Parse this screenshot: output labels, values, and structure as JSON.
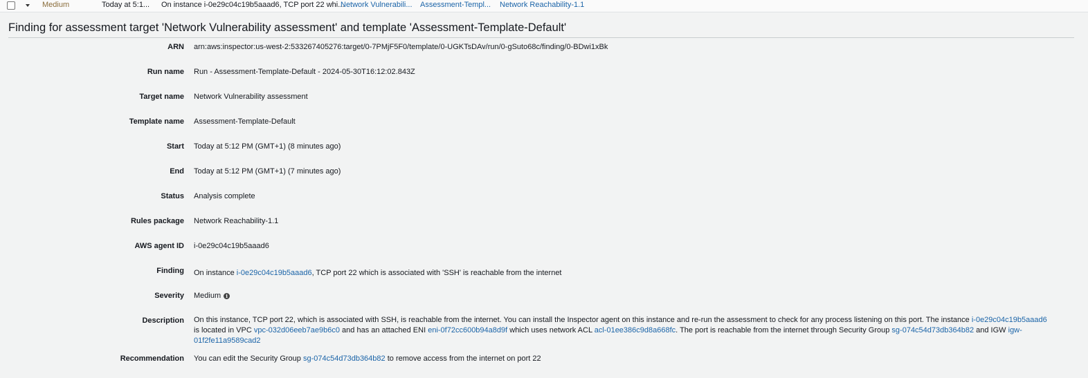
{
  "list_row": {
    "severity": "Medium",
    "date": "Today at 5:1...",
    "finding": "On instance i-0e29c04c19b5aaad6, TCP port 22 whi...",
    "target": "Network Vulnerabili...",
    "template": "Assessment-Templ...",
    "rules_package": "Network Reachability-1.1"
  },
  "panel": {
    "title": "Finding for assessment target 'Network Vulnerability assessment' and template 'Assessment-Template-Default'"
  },
  "fields": {
    "arn": {
      "label": "ARN",
      "value": "arn:aws:inspector:us-west-2:533267405276:target/0-7PMjF5F0/template/0-UGKTsDAv/run/0-gSuto68c/finding/0-BDwi1xBk"
    },
    "run_name": {
      "label": "Run name",
      "value": "Run - Assessment-Template-Default - 2024-05-30T16:12:02.843Z"
    },
    "target_name": {
      "label": "Target name",
      "value": "Network Vulnerability assessment"
    },
    "template_name": {
      "label": "Template name",
      "value": "Assessment-Template-Default"
    },
    "start": {
      "label": "Start",
      "value": "Today at 5:12 PM (GMT+1) (8 minutes ago)"
    },
    "end": {
      "label": "End",
      "value": "Today at 5:12 PM (GMT+1) (7 minutes ago)"
    },
    "status": {
      "label": "Status",
      "value": "Analysis complete"
    },
    "rules_package": {
      "label": "Rules package",
      "value": "Network Reachability-1.1"
    },
    "agent_id": {
      "label": "AWS agent ID",
      "value": "i-0e29c04c19b5aaad6"
    },
    "finding": {
      "label": "Finding",
      "pre": "On instance ",
      "instance": "i-0e29c04c19b5aaad6",
      "post": ", TCP port 22 which is associated with 'SSH' is reachable from the internet"
    },
    "severity": {
      "label": "Severity",
      "value": "Medium",
      "icon": "info-icon"
    },
    "description": {
      "label": "Description",
      "t1": "On this instance, TCP port 22, which is associated with SSH, is reachable from the internet. You can install the Inspector agent on this instance and re-run the assessment to check for any process listening on this port. The instance ",
      "instance": "i-0e29c04c19b5aaad6",
      "t2": " is located in VPC ",
      "vpc": "vpc-032d06eeb7ae9b6c0",
      "t3": " and has an attached ENI ",
      "eni": "eni-0f72cc600b94a8d9f",
      "t4": " which uses network ACL ",
      "acl": "acl-01ee386c9d8a668fc",
      "t5": ". The port is reachable from the internet through Security Group ",
      "sg": "sg-074c54d73db364b82",
      "t6": " and IGW ",
      "igw": "igw-01f2fe11a9589cad2"
    },
    "recommendation": {
      "label": "Recommendation",
      "pre": "You can edit the Security Group ",
      "sg": "sg-074c54d73db364b82",
      "post": " to remove access from the internet on port 22"
    }
  },
  "colors": {
    "link": "#1b64a8",
    "background": "#f2f3f3",
    "severity_medium": "#8a6d3b"
  }
}
